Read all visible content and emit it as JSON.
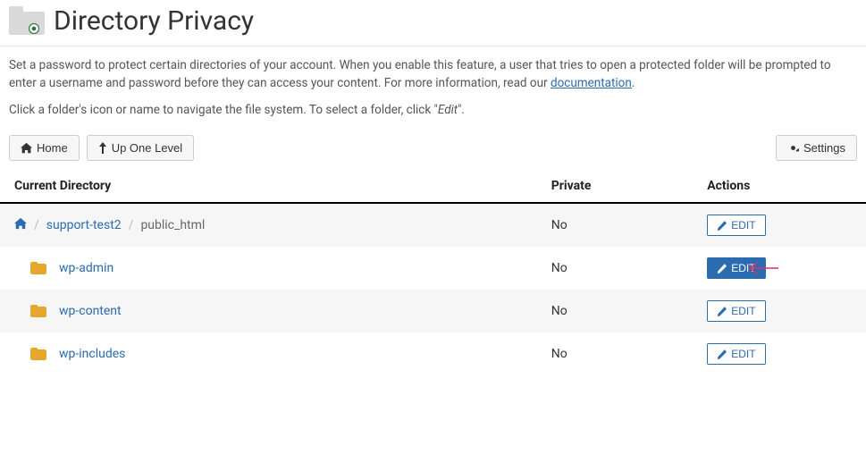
{
  "header": {
    "title": "Directory Privacy"
  },
  "intro": {
    "text_before_link": "Set a password to protect certain directories of your account. When you enable this feature, a user that tries to open a protected folder will be prompted to enter a username and password before they can access your content. For more information, read our ",
    "link_text": "documentation",
    "text_after_link": "."
  },
  "intro_sub": {
    "prefix": "Click a folder's icon or name to navigate the file system. To select a folder, click \"",
    "em": "Edit",
    "suffix": "\"."
  },
  "toolbar": {
    "home_label": "Home",
    "up_label": "Up One Level",
    "settings_label": "Settings"
  },
  "columns": {
    "dir": "Current Directory",
    "private": "Private",
    "actions": "Actions"
  },
  "breadcrumb": {
    "segment1": "support-test2",
    "segment2": "public_html",
    "private": "No",
    "edit": "EDIT"
  },
  "rows": [
    {
      "name": "wp-admin",
      "private": "No",
      "edit": "EDIT",
      "highlight": true
    },
    {
      "name": "wp-content",
      "private": "No",
      "edit": "EDIT",
      "highlight": false
    },
    {
      "name": "wp-includes",
      "private": "No",
      "edit": "EDIT",
      "highlight": false
    }
  ]
}
